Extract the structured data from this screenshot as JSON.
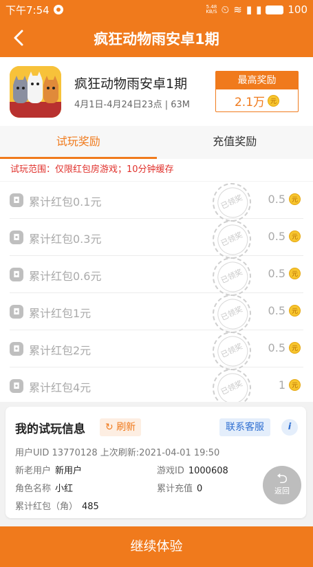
{
  "statusbar": {
    "time": "下午7:54",
    "net_speed_top": "5.48",
    "net_speed_bottom": "KB/S",
    "battery": "100"
  },
  "header": {
    "title": "疯狂动物雨安卓1期"
  },
  "game": {
    "name": "疯狂动物雨安卓1期",
    "meta": "4月1日-4月24日23点 | 63M",
    "reward_title": "最高奖励",
    "reward_value": "2.1万"
  },
  "tabs": [
    {
      "label": "试玩奖励",
      "active": true
    },
    {
      "label": "充值奖励",
      "active": false
    }
  ],
  "scope_text": "试玩范围：仅限红包房游戏；10分钟缓存",
  "coin_glyph": "元",
  "stamp_text": "已领奖",
  "rewards": [
    {
      "label": "累计红包0.1元",
      "value": "0.5"
    },
    {
      "label": "累计红包0.3元",
      "value": "0.5"
    },
    {
      "label": "累计红包0.6元",
      "value": "0.5"
    },
    {
      "label": "累计红包1元",
      "value": "0.5"
    },
    {
      "label": "累计红包2元",
      "value": "0.5"
    },
    {
      "label": "累计红包4元",
      "value": "1"
    }
  ],
  "info": {
    "title": "我的试玩信息",
    "refresh_label": "刷新",
    "contact_label": "联系客服",
    "info_icon_glyph": "i",
    "uid_line": "用户UID 13770128    上次刷新:2021-04-01 19:50",
    "user_type_label": "新老用户",
    "user_type_value": "新用户",
    "game_id_label": "游戏ID",
    "game_id_value": "1000608",
    "role_label": "角色名称",
    "role_value": "小红",
    "recharge_label": "累计充值",
    "recharge_value": "0",
    "redpack_label": "累计红包（角）",
    "redpack_value": "485"
  },
  "float_back": {
    "label": "返回"
  },
  "cta": {
    "label": "继续体验"
  },
  "colors": {
    "accent": "#f07a1c",
    "link": "#2f6fd1",
    "danger": "#e0302b"
  }
}
